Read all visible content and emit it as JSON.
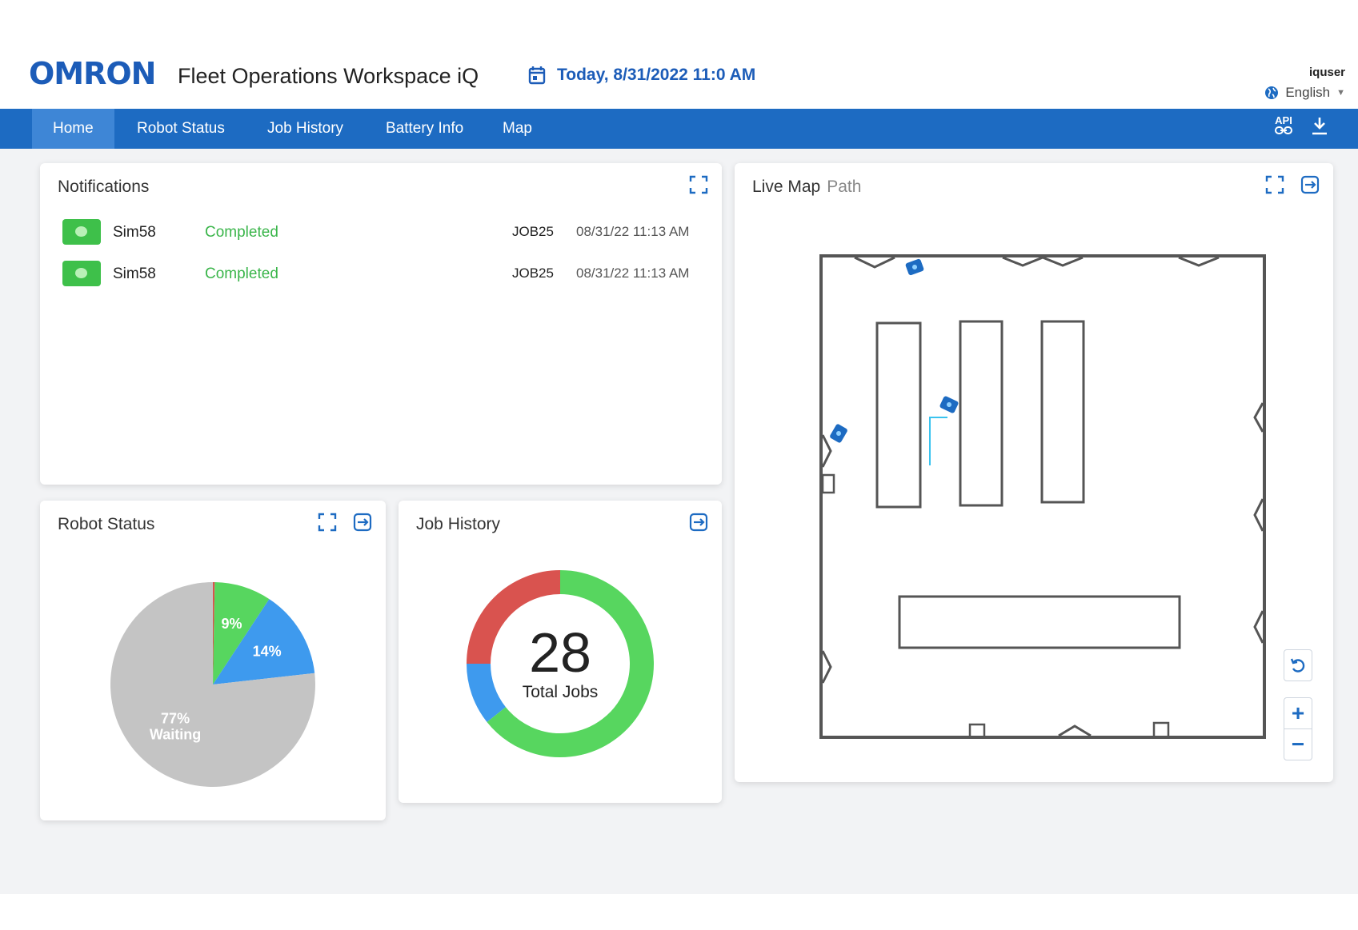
{
  "header": {
    "logo": "OMRON",
    "app_title": "Fleet Operations Workspace iQ",
    "date": "Today, 8/31/2022 11:0 AM",
    "username": "iquser",
    "language": "English"
  },
  "nav": {
    "tabs": [
      {
        "label": "Home",
        "active": true
      },
      {
        "label": "Robot Status",
        "active": false
      },
      {
        "label": "Job History",
        "active": false
      },
      {
        "label": "Battery Info",
        "active": false
      },
      {
        "label": "Map",
        "active": false
      }
    ],
    "api_label": "API"
  },
  "notifications": {
    "title": "Notifications",
    "rows": [
      {
        "robot": "Sim58",
        "status": "Completed",
        "job": "JOB25",
        "time": "08/31/22 11:13 AM"
      },
      {
        "robot": "Sim58",
        "status": "Completed",
        "job": "JOB25",
        "time": "08/31/22 11:13 AM"
      }
    ]
  },
  "robot_status": {
    "title": "Robot Status"
  },
  "job_history": {
    "title": "Job History",
    "total": "28",
    "total_label": "Total Jobs"
  },
  "live_map": {
    "title": "Live Map",
    "tab_path": "Path"
  },
  "colors": {
    "brand_blue": "#1d6bc2",
    "nav_active": "#3e86d6",
    "completed_green": "#3ab54a",
    "pie_waiting": "#c4c4c4",
    "pie_green": "#57d65f",
    "pie_blue": "#3e9aee",
    "pie_red": "#d9534f"
  },
  "chart_data": [
    {
      "type": "pie",
      "categories": [
        "Waiting",
        "Green",
        "Blue",
        "Red"
      ],
      "values": [
        77,
        9,
        14,
        0.3
      ],
      "labels": [
        "77%\nWaiting",
        "9%",
        "14%",
        ""
      ],
      "colors": [
        "#c4c4c4",
        "#57d65f",
        "#3e9aee",
        "#d9534f"
      ]
    },
    {
      "type": "pie",
      "style": "donut",
      "categories": [
        "Green",
        "Blue",
        "Red"
      ],
      "values": [
        18,
        3,
        7
      ],
      "colors": [
        "#57d65f",
        "#3e9aee",
        "#d9534f"
      ],
      "center_value": "28",
      "center_label": "Total Jobs"
    }
  ]
}
